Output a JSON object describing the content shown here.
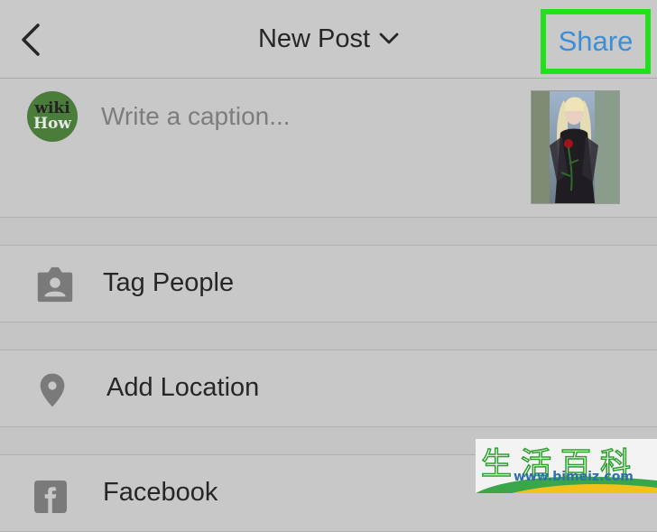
{
  "header": {
    "title": "New Post",
    "share_label": "Share",
    "back_icon": "chevron-left-icon",
    "title_dropdown_icon": "chevron-down-icon",
    "share_highlight_color": "#22e01c",
    "share_color": "#3a8fd8"
  },
  "caption": {
    "placeholder": "Write a caption...",
    "value": "",
    "avatar_text_line1": "wiki",
    "avatar_text_line2": "How"
  },
  "options": [
    {
      "label": "Tag People",
      "icon": "person-tag-icon"
    },
    {
      "label": "Add Location",
      "icon": "location-pin-icon"
    },
    {
      "label": "Facebook",
      "icon": "facebook-icon"
    }
  ],
  "watermark": {
    "text": "生活百科",
    "url": "www.bimeiz.com"
  }
}
